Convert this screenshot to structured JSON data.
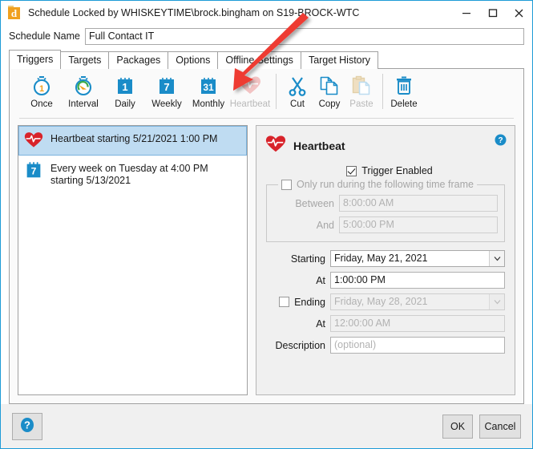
{
  "window": {
    "title": "Schedule Locked by WHISKEYTIME\\brock.bingham on S19-BROCK-WTC",
    "app_icon": "orange-d-icon",
    "minimize_label": "—",
    "maximize_label": "□",
    "close_label": "✕",
    "accent_color": "#1e9bd7"
  },
  "schedule": {
    "name_label": "Schedule Name",
    "name_value": "Full Contact IT",
    "name_placeholder": "Schedule Name"
  },
  "tabs": [
    {
      "label": "Triggers",
      "active": true
    },
    {
      "label": "Targets",
      "active": false
    },
    {
      "label": "Packages",
      "active": false
    },
    {
      "label": "Options",
      "active": false
    },
    {
      "label": "Offline Settings",
      "active": false
    },
    {
      "label": "Target History",
      "active": false
    }
  ],
  "toolbar": [
    {
      "label": "Once",
      "icon": "stopwatch-1-icon",
      "disabled": false
    },
    {
      "label": "Interval",
      "icon": "stopwatch-arrow-icon",
      "disabled": false
    },
    {
      "label": "Daily",
      "icon": "calendar-1-icon",
      "disabled": false
    },
    {
      "label": "Weekly",
      "icon": "calendar-7-icon",
      "disabled": false
    },
    {
      "label": "Monthly",
      "icon": "calendar-31-icon",
      "disabled": false
    },
    {
      "label": "Heartbeat",
      "icon": "heartbeat-icon",
      "disabled": true
    },
    {
      "label": "Cut",
      "icon": "scissors-icon",
      "disabled": false
    },
    {
      "label": "Copy",
      "icon": "copy-pages-icon",
      "disabled": false
    },
    {
      "label": "Paste",
      "icon": "clipboard-paste-icon",
      "disabled": true
    },
    {
      "label": "Delete",
      "icon": "trash-icon",
      "disabled": false
    }
  ],
  "trigger_list": [
    {
      "icon": "heartbeat-icon",
      "text": "Heartbeat starting 5/21/2021 1:00 PM",
      "selected": true
    },
    {
      "icon": "calendar-7-icon",
      "text": "Every week on Tuesday at 4:00 PM starting 5/13/2021",
      "selected": false
    }
  ],
  "detail": {
    "icon": "heartbeat-icon",
    "title": "Heartbeat",
    "help_icon": "help-question-icon",
    "trigger_enabled": {
      "label": "Trigger Enabled",
      "checked": true
    },
    "time_frame": {
      "legend_label": "Only run during the following time frame",
      "checked": false,
      "between_label": "Between",
      "between_value": "8:00:00 AM",
      "and_label": "And",
      "and_value": "5:00:00 PM"
    },
    "starting": {
      "label": "Starting",
      "value": "Friday, May 21, 2021",
      "arrow": "chevron-down-icon"
    },
    "starting_at": {
      "label": "At",
      "value": "1:00:00 PM"
    },
    "ending": {
      "label": "Ending",
      "checked": false,
      "value": "Friday, May 28, 2021",
      "arrow": "chevron-down-icon"
    },
    "ending_at": {
      "label": "At",
      "value": "12:00:00 AM"
    },
    "description": {
      "label": "Description",
      "placeholder": "(optional)",
      "value": ""
    }
  },
  "footer": {
    "help_icon": "help-question-icon",
    "ok_label": "OK",
    "cancel_label": "Cancel"
  },
  "annotation": {
    "type": "red-arrow",
    "color": "#ee3b33",
    "points_to": "Heartbeat"
  }
}
